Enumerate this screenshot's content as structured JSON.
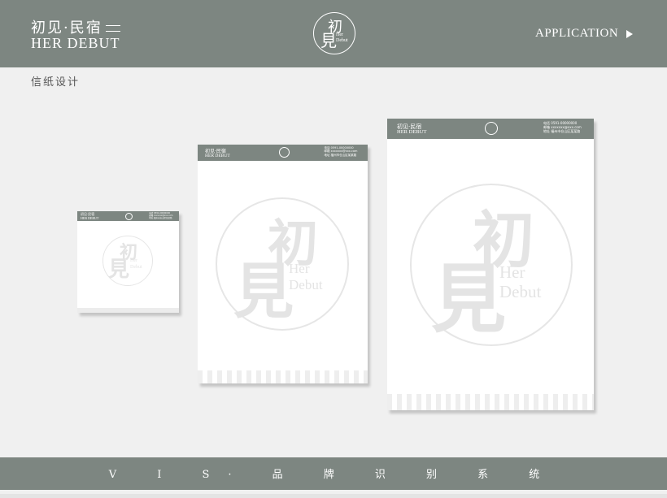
{
  "header": {
    "brand_cn": "初见·民宿",
    "brand_en": "HER DEBUT",
    "logo_chars": [
      "初",
      "見"
    ],
    "logo_text": [
      "Her",
      "Debut"
    ],
    "application_label": "APPLICATION"
  },
  "subtitle": "信纸设计",
  "footer": "V I S· 品 牌 识 别 系 统",
  "letterhead": {
    "brand_cn": "初见·民宿",
    "brand_en": "HER DEBUT",
    "contact": [
      "电话 0591-00000000",
      "邮箱 xxxxxxx@xxx.com",
      "地址 福州市仓山区某某路"
    ],
    "watermark_chars": [
      "初",
      "見"
    ],
    "watermark_text": [
      "Her",
      "Debut"
    ]
  },
  "colors": {
    "bar": "#7d8681",
    "background": "#f0f0f0",
    "paper": "#ffffff",
    "watermark": "#e4e4e4"
  }
}
